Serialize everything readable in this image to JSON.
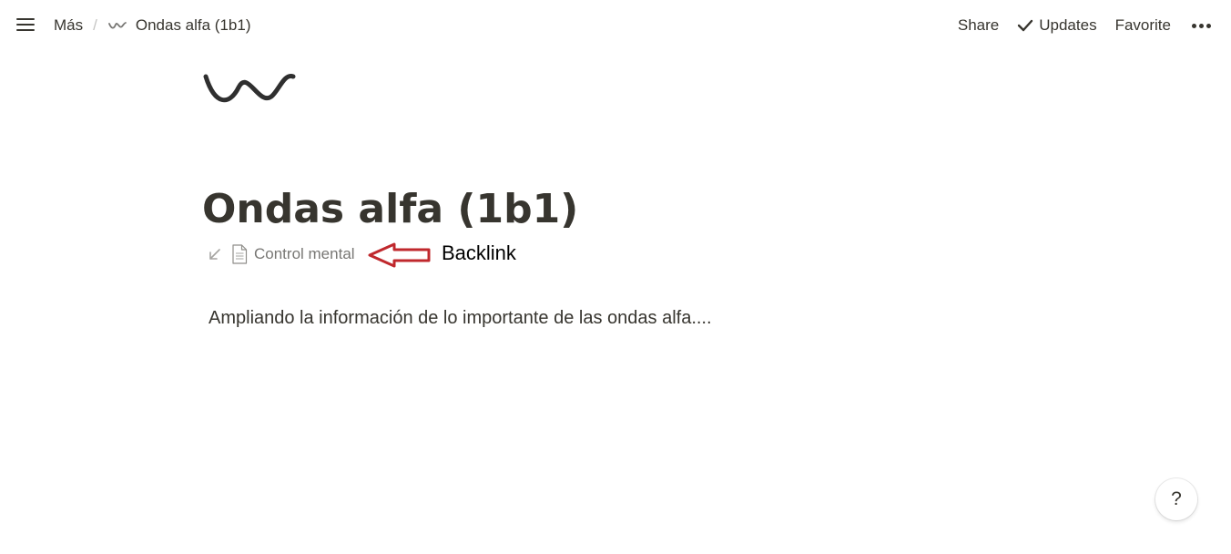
{
  "topbar": {
    "breadcrumb": {
      "parent": "Más",
      "separator": "/",
      "current": "Ondas alfa (1b1)"
    },
    "actions": {
      "share": "Share",
      "updates": "Updates",
      "favorite": "Favorite"
    }
  },
  "page": {
    "icon": "wave-icon",
    "title": "Ondas alfa (1b1)",
    "backlinks": [
      {
        "label": "Control mental",
        "icon": "document-icon"
      }
    ],
    "body": "Ampliando la información de lo importante de las ondas alfa...."
  },
  "annotation": {
    "label": "Backlink",
    "color": "#c0282d"
  },
  "help": {
    "label": "?"
  }
}
